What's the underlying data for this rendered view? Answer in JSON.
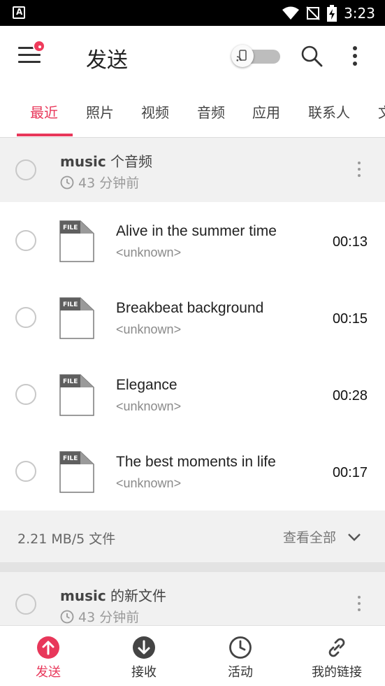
{
  "status_bar": {
    "left_icon": "a-icon",
    "icons": [
      "wifi-icon",
      "no-signal-icon",
      "battery-charging-icon"
    ],
    "time": "3:23"
  },
  "toolbar": {
    "title": "发送",
    "menu_icon": "hamburger-menu-icon",
    "toggle_state": "off",
    "search_icon": "search-icon",
    "more_icon": "more-vert-icon"
  },
  "tabs": [
    {
      "label": "最近",
      "active": true
    },
    {
      "label": "照片"
    },
    {
      "label": "视频"
    },
    {
      "label": "音频"
    },
    {
      "label": "应用"
    },
    {
      "label": "联系人"
    },
    {
      "label": "文"
    }
  ],
  "groups": [
    {
      "title_bold": "music",
      "title_rest": " 个音频",
      "time": "43 分钟前",
      "items": [
        {
          "name": "Alive in the summer time",
          "artist": "<unknown>",
          "duration": "00:13",
          "icon_label": "FILE"
        },
        {
          "name": "Breakbeat background",
          "artist": "<unknown>",
          "duration": "00:15",
          "icon_label": "FILE"
        },
        {
          "name": "Elegance",
          "artist": "<unknown>",
          "duration": "00:28",
          "icon_label": "FILE"
        },
        {
          "name": "The best moments in life",
          "artist": "<unknown>",
          "duration": "00:17",
          "icon_label": "FILE"
        }
      ],
      "footer": {
        "size": "2.21 MB/5 文件",
        "view_all": "查看全部"
      }
    },
    {
      "title_bold": "music",
      "title_rest": " 的新文件",
      "time": "43 分钟前"
    }
  ],
  "bottom_nav": [
    {
      "label": "发送",
      "icon": "upload-arrow-icon",
      "active": true
    },
    {
      "label": "接收",
      "icon": "download-arrow-icon"
    },
    {
      "label": "活动",
      "icon": "clock-icon"
    },
    {
      "label": "我的链接",
      "icon": "link-icon"
    }
  ],
  "colors": {
    "accent": "#e8375a",
    "group_bg": "#f1f1f1",
    "text_primary": "#222222",
    "text_secondary": "#8a8a8a"
  }
}
